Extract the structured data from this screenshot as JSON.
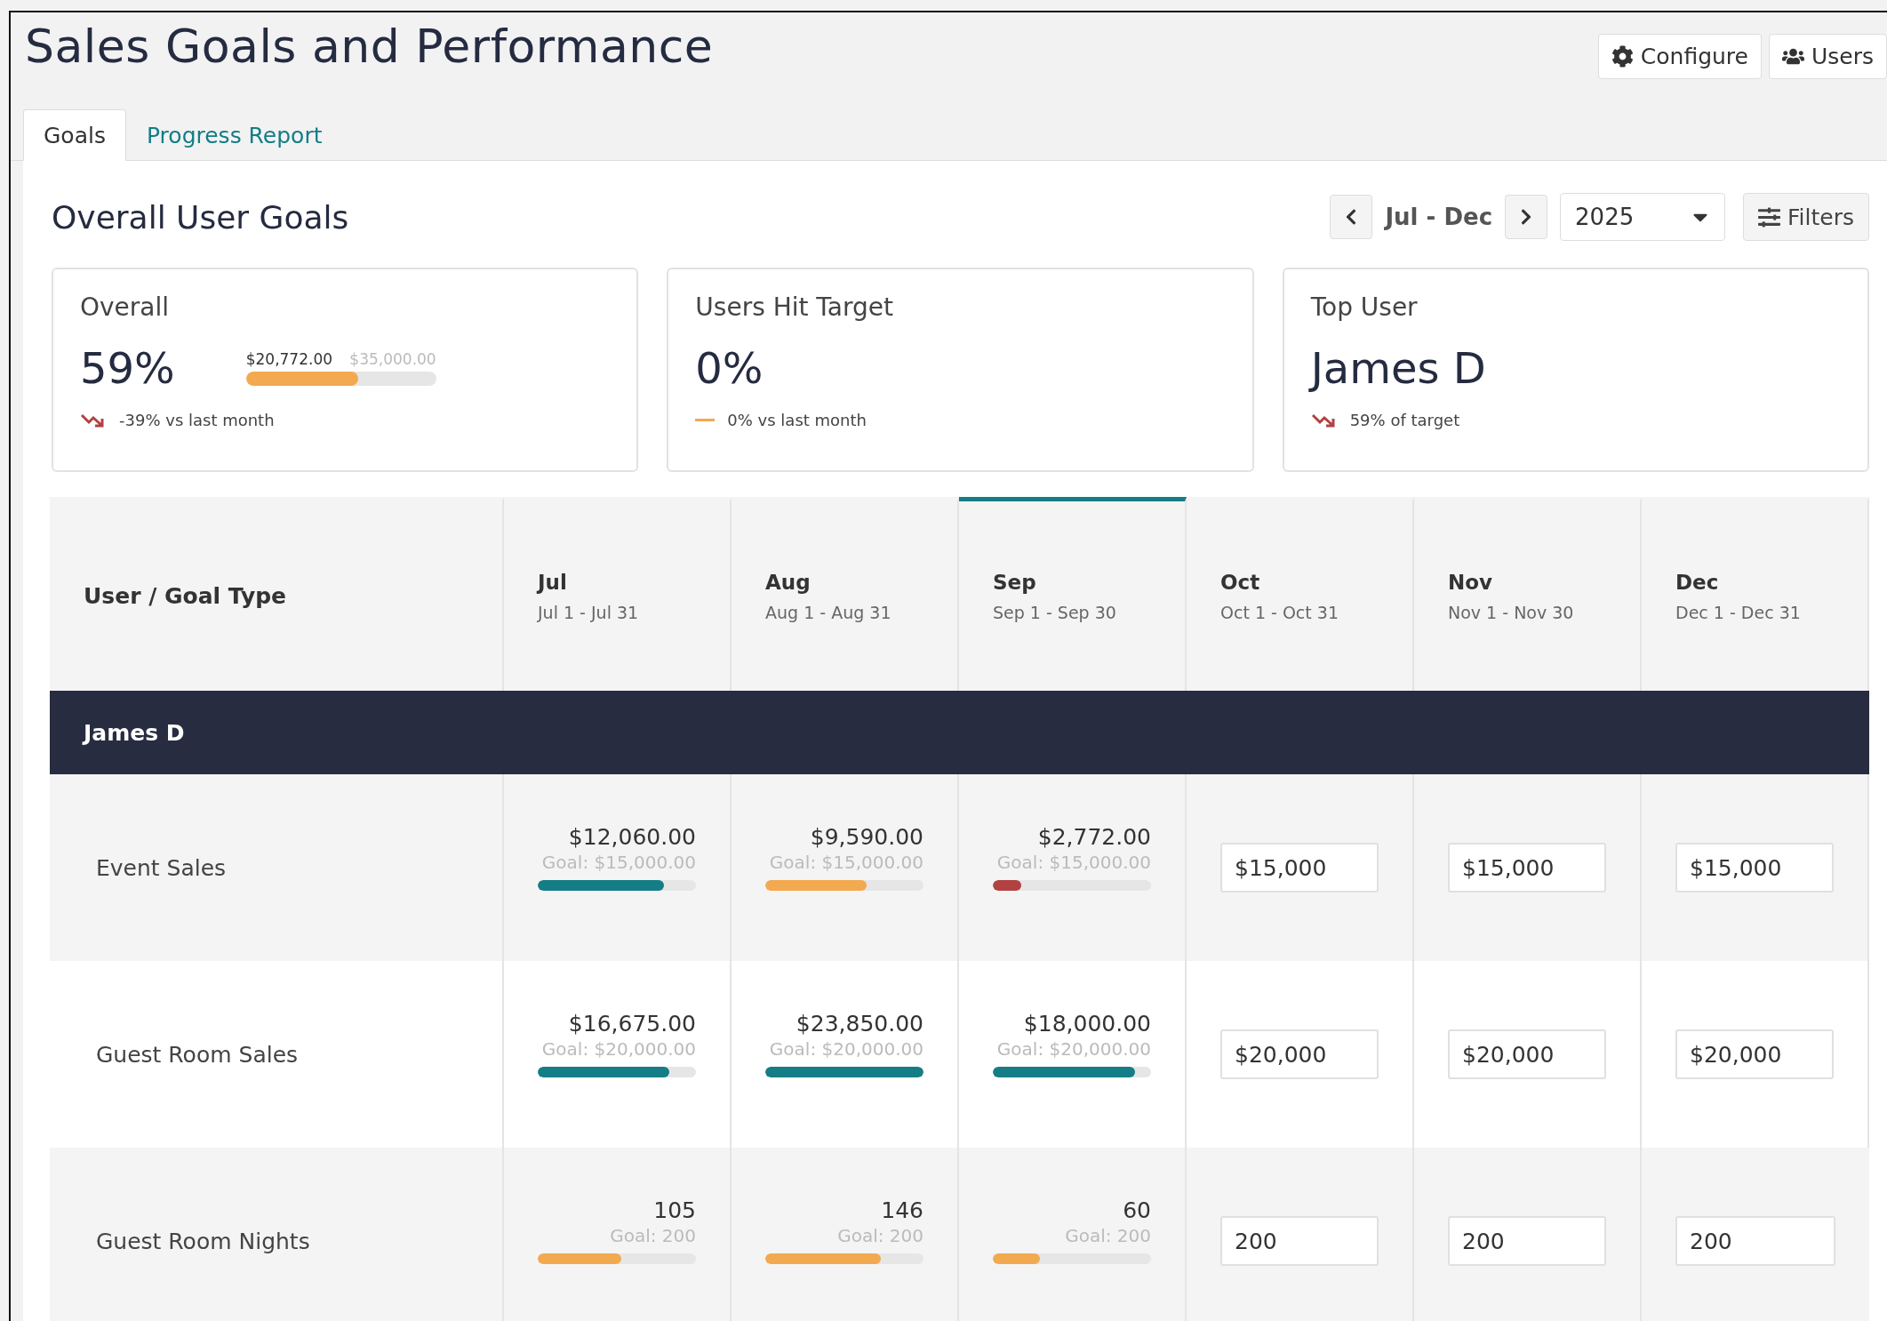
{
  "title": "Sales Goals and Performance",
  "header_buttons": [
    {
      "label": "Configure"
    },
    {
      "label": "Users"
    }
  ],
  "tabs": [
    {
      "label": "Goals",
      "selected": true
    },
    {
      "label": "Progress Report",
      "selected": false
    }
  ],
  "section_title": "Overall User Goals",
  "period": {
    "label": "Jul - Dec",
    "year": "2025",
    "filters": "Filters"
  },
  "cards": [
    {
      "title": "Overall",
      "value": "59%",
      "kind": "down",
      "note": "-39% vs last month",
      "progress": {
        "current": "$20,772.00",
        "target": "$35,000.00",
        "level": 0.59
      }
    },
    {
      "title": "Users Hit Target",
      "value": "0%",
      "kind": "flat",
      "note": "0% vs last month"
    },
    {
      "title": "Top User",
      "value": "James D",
      "kind": "down",
      "note": "59% of target"
    }
  ],
  "table": {
    "first_column": "User / Goal Type",
    "columns": [
      {
        "month": "Jul",
        "range": "Jul 1 - Jul 31",
        "selected": false
      },
      {
        "month": "Aug",
        "range": "Aug 1 - Aug 31",
        "selected": false
      },
      {
        "month": "Sep",
        "range": "Sep 1 - Sep 30",
        "selected": true
      },
      {
        "month": "Oct",
        "range": "Oct 1 - Oct 31",
        "selected": false
      },
      {
        "month": "Nov",
        "range": "Nov 1 - Nov 30",
        "selected": false
      },
      {
        "month": "Dec",
        "range": "Dec 1 - Dec 31",
        "selected": false
      }
    ],
    "groups": [
      {
        "user": "James D",
        "rows": [
          {
            "goal_type": "Event Sales",
            "cells": [
              {
                "kind": "progress",
                "actual": "$12,060.00",
                "goal": "Goal: $15,000.00",
                "level": 0.8,
                "color": "#147d85"
              },
              {
                "kind": "progress",
                "actual": "$9,590.00",
                "goal": "Goal: $15,000.00",
                "level": 0.64,
                "color": "#f3a94f"
              },
              {
                "kind": "progress",
                "actual": "$2,772.00",
                "goal": "Goal: $15,000.00",
                "level": 0.18,
                "color": "#b24141"
              },
              {
                "kind": "input",
                "value": "$15,000"
              },
              {
                "kind": "input",
                "value": "$15,000"
              },
              {
                "kind": "input",
                "value": "$15,000"
              }
            ]
          },
          {
            "goal_type": "Guest Room Sales",
            "cells": [
              {
                "kind": "progress",
                "actual": "$16,675.00",
                "goal": "Goal: $20,000.00",
                "level": 0.83,
                "color": "#147d85"
              },
              {
                "kind": "progress",
                "actual": "$23,850.00",
                "goal": "Goal: $20,000.00",
                "level": 1,
                "color": "#147d85"
              },
              {
                "kind": "progress",
                "actual": "$18,000.00",
                "goal": "Goal: $20,000.00",
                "level": 0.9,
                "color": "#147d85"
              },
              {
                "kind": "input",
                "value": "$20,000"
              },
              {
                "kind": "input",
                "value": "$20,000"
              },
              {
                "kind": "input",
                "value": "$20,000"
              }
            ]
          },
          {
            "goal_type": "Guest Room Nights",
            "cells": [
              {
                "kind": "progress",
                "actual": "105",
                "goal": "Goal: 200",
                "level": 0.53,
                "color": "#f3a94f"
              },
              {
                "kind": "progress",
                "actual": "146",
                "goal": "Goal: 200",
                "level": 0.73,
                "color": "#f3a94f"
              },
              {
                "kind": "progress",
                "actual": "60",
                "goal": "Goal: 200",
                "level": 0.3,
                "color": "#f3a94f"
              },
              {
                "kind": "input",
                "value": "200"
              },
              {
                "kind": "input",
                "value": "200"
              },
              {
                "kind": "input",
                "value": "200"
              }
            ]
          }
        ]
      }
    ]
  }
}
